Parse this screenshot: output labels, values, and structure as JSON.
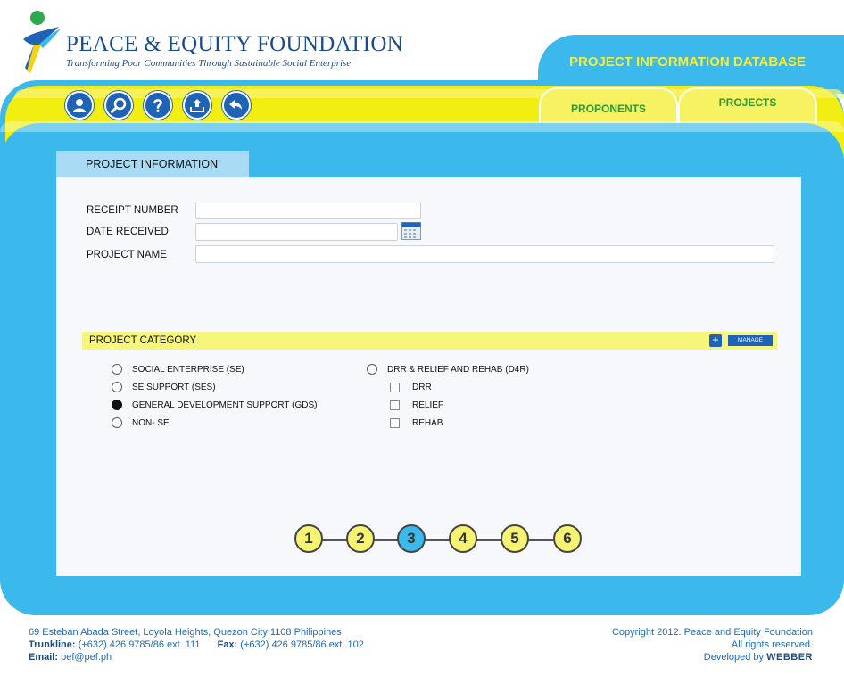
{
  "header": {
    "org_name": "PEACE & EQUITY FOUNDATION",
    "tagline": "Transforming Poor Communities Through Sustainable Social Enterprise",
    "db_title": "PROJECT INFORMATION DATABASE"
  },
  "toolbar": {
    "icons": [
      "user-icon",
      "search-icon",
      "help-icon",
      "upload-icon",
      "back-icon"
    ]
  },
  "nav": {
    "proponents": "PROPONENTS",
    "projects": "PROJECTS"
  },
  "section_tab": "PROJECT INFORMATION",
  "form": {
    "receipt_label": "RECEIPT NUMBER",
    "receipt_value": "",
    "date_label": "DATE RECEIVED",
    "date_value": "",
    "project_name_label": "PROJECT NAME",
    "project_name_value": ""
  },
  "category": {
    "title": "PROJECT CATEGORY",
    "plus": "+",
    "manage": "MANAGE",
    "left_options": [
      {
        "label": "SOCIAL ENTERPRISE (SE)",
        "selected": false
      },
      {
        "label": "SE SUPPORT (SES)",
        "selected": false
      },
      {
        "label": "GENERAL DEVELOPMENT SUPPORT (GDS)",
        "selected": true
      },
      {
        "label": "NON- SE",
        "selected": false
      }
    ],
    "right_radio": {
      "label": "DRR & RELIEF AND REHAB (D4R)",
      "selected": false
    },
    "right_checks": [
      {
        "label": "DRR",
        "checked": false
      },
      {
        "label": "RELIEF",
        "checked": false
      },
      {
        "label": "REHAB",
        "checked": false
      }
    ]
  },
  "stepper": {
    "steps": [
      "1",
      "2",
      "3",
      "4",
      "5",
      "6"
    ],
    "active": "3"
  },
  "footer": {
    "address": "69 Esteban Abada Street, Loyola Heights, Quezon City 1108 Philippines",
    "trunkline_label": "Trunkline:",
    "trunkline_value": "(+632) 426 9785/86 ext. 111",
    "fax_label": "Fax:",
    "fax_value": "(+632) 426 9785/86 ext. 102",
    "email_label": "Email:",
    "email_value": "pef@pef.ph",
    "copyright": "Copyright 2012. Peace and Equity Foundation",
    "rights": "All rights reserved.",
    "developed_by": "Developed by",
    "developer": "WEBBER"
  }
}
